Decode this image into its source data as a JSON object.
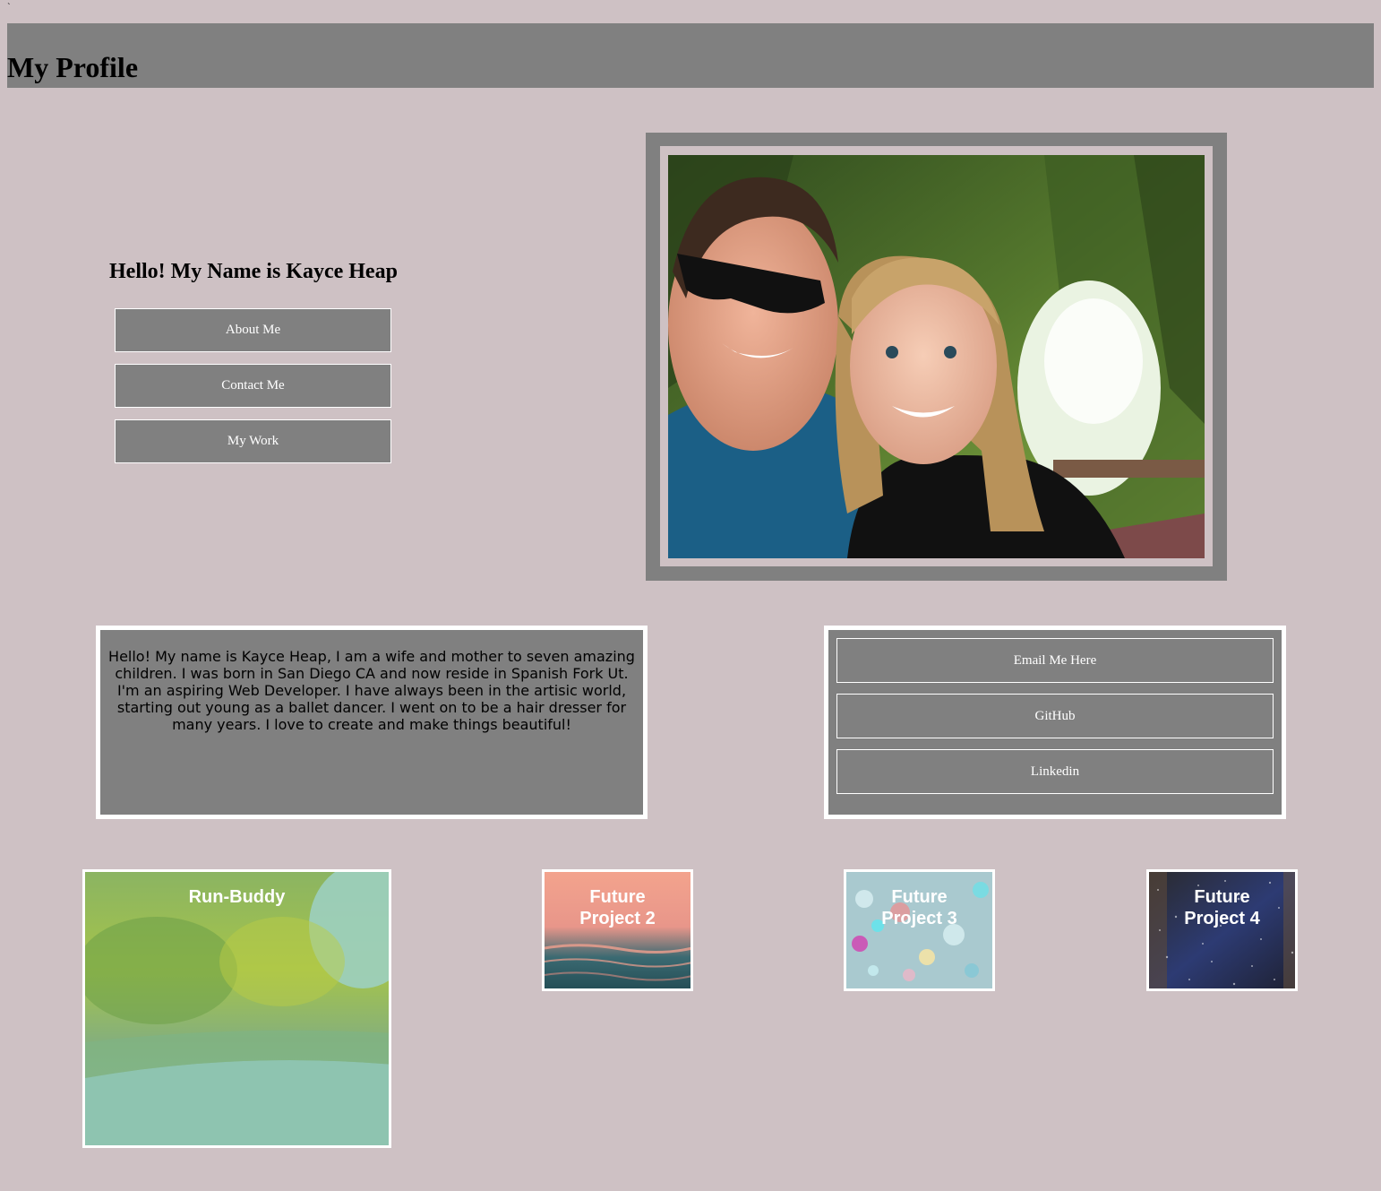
{
  "stray_mark": "`",
  "header": {
    "title": "My Profile"
  },
  "intro": {
    "greeting": "Hello! My Name is Kayce Heap"
  },
  "nav": {
    "about": "About Me",
    "contact": "Contact Me",
    "work": "My Work"
  },
  "about": {
    "text": "Hello! My name is Kayce Heap, I am a wife and mother to seven amazing children. I was born in San Diego CA and now reside in Spanish Fork Ut. I'm an aspiring Web Developer. I have always been in the artisic world, starting out young as a ballet dancer. I went on to be a hair dresser for many years. I love to create and make things beautiful!"
  },
  "contact": {
    "email": "Email Me Here",
    "github": "GitHub",
    "linkedin": "Linkedin"
  },
  "projects": [
    {
      "title": "Run-Buddy"
    },
    {
      "title": "Future Project 2"
    },
    {
      "title": "Future Project 3"
    },
    {
      "title": "Future Project 4"
    }
  ],
  "colors": {
    "background": "#cec1c4",
    "panel": "#808080",
    "border": "#ffffff"
  }
}
